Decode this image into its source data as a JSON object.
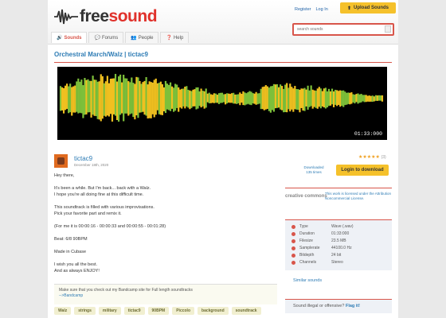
{
  "header": {
    "logo_text_free": "free",
    "logo_text_sound": "sound",
    "register": "Register",
    "login": "Log In",
    "upload": "Upload Sounds",
    "search_placeholder": "search sounds"
  },
  "tabs": [
    {
      "label": "Sounds",
      "icon": "speaker-icon",
      "active": true
    },
    {
      "label": "Forums",
      "icon": "chat-icon",
      "active": false
    },
    {
      "label": "People",
      "icon": "people-icon",
      "active": false
    },
    {
      "label": "Help",
      "icon": "help-icon",
      "active": false
    }
  ],
  "sound": {
    "title": "Orchestral March/Walz | tictac9",
    "duration_display": "01:33:000",
    "user": "tictac9",
    "date": "December 18th, 2020",
    "rating_count": "(3)",
    "downloaded_label": "Downloaded",
    "downloaded_count": "135 times",
    "download_button": "Login to download",
    "description": [
      "Hey there,",
      "It's been a while. But I'm back... back with a Walz.\nI hope you're all doing fine at this difficult time.",
      "This soundtrack is filled with various improvisations.\nPick your favorite part and remix it.",
      "(For me it is 00:00:16 - 00:00:33 and 00:00:55 - 00:01:28)",
      "Beat: 6/8 90BPM",
      "Made in Cubase",
      "I wish you all the best.\nAnd as always ENJOY!"
    ],
    "license_logo": "creative commons",
    "license_text": "This work is licensed under the Attribution Noncommercial License.",
    "info": [
      {
        "k": "Type",
        "v": "Wave (.wav)"
      },
      {
        "k": "Duration",
        "v": "01:33:000"
      },
      {
        "k": "Filesize",
        "v": "23.5 MB"
      },
      {
        "k": "Samplerate",
        "v": "44100.0 Hz"
      },
      {
        "k": "Bitdepth",
        "v": "24 bit"
      },
      {
        "k": "Channels",
        "v": "Stereo"
      }
    ],
    "similar": "Similar sounds",
    "illegal_text": "Sound illegal or offensive?",
    "illegal_link": "Flag it!",
    "footer_text": "Make sure that you check out my Bandcamp site for Full length soundtracks",
    "footer_link": "-->Bandcamp",
    "tags": [
      "Walz",
      "strings",
      "military",
      "tictac9",
      "90BPM",
      "Piccolo",
      "background",
      "soundtrack"
    ]
  },
  "colors": {
    "accent": "#d8554a",
    "link": "#2e7cb5",
    "button": "#f5c12b",
    "wave_yellow": "#f0c020",
    "wave_green": "#7dc03a"
  }
}
